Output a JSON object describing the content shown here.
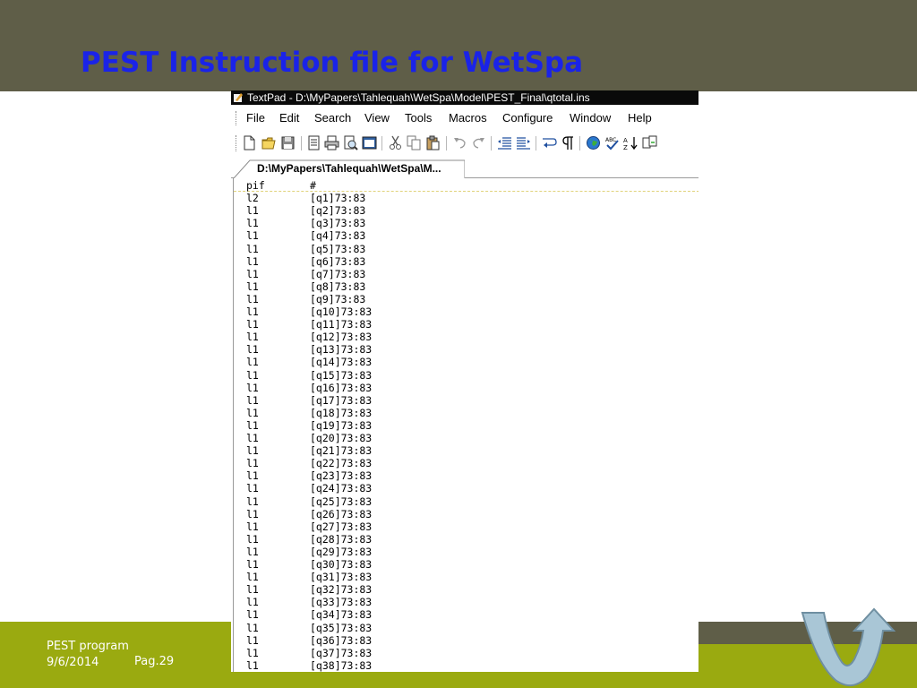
{
  "slide": {
    "title": "PEST Instruction file for WetSpa",
    "footer_program": "PEST program",
    "footer_date": "9/6/2014",
    "footer_page": "Pag.29"
  },
  "window": {
    "title": "TextPad - D:\\MyPapers\\Tahlequah\\WetSpa\\Model\\PEST_Final\\qtotal.ins",
    "menus": [
      "File",
      "Edit",
      "Search",
      "View",
      "Tools",
      "Macros",
      "Configure",
      "Window",
      "Help"
    ],
    "toolbar_icons": [
      "new-file-icon",
      "open-folder-icon",
      "save-icon",
      "document-properties-icon",
      "print-icon",
      "print-preview-icon",
      "manage-files-icon",
      "cut-icon",
      "copy-icon",
      "paste-icon",
      "undo-icon",
      "redo-icon",
      "decrease-indent-icon",
      "increase-indent-icon",
      "word-wrap-icon",
      "visible-spaces-icon",
      "web-browser-icon",
      "spell-check-icon",
      "sort-icon",
      "compare-icon"
    ],
    "tab_label": "D:\\MyPapers\\Tahlequah\\WetSpa\\M...",
    "colors": {
      "titlebar_bg": "#0a0a0a",
      "slide_band": "#5f5e48",
      "footer_band": "#9aaa10",
      "title_text": "#1a23e8"
    }
  },
  "file_lines": [
    [
      "pif",
      "#"
    ],
    [
      "l2",
      "[q1]73:83"
    ],
    [
      "l1",
      "[q2]73:83"
    ],
    [
      "l1",
      "[q3]73:83"
    ],
    [
      "l1",
      "[q4]73:83"
    ],
    [
      "l1",
      "[q5]73:83"
    ],
    [
      "l1",
      "[q6]73:83"
    ],
    [
      "l1",
      "[q7]73:83"
    ],
    [
      "l1",
      "[q8]73:83"
    ],
    [
      "l1",
      "[q9]73:83"
    ],
    [
      "l1",
      "[q10]73:83"
    ],
    [
      "l1",
      "[q11]73:83"
    ],
    [
      "l1",
      "[q12]73:83"
    ],
    [
      "l1",
      "[q13]73:83"
    ],
    [
      "l1",
      "[q14]73:83"
    ],
    [
      "l1",
      "[q15]73:83"
    ],
    [
      "l1",
      "[q16]73:83"
    ],
    [
      "l1",
      "[q17]73:83"
    ],
    [
      "l1",
      "[q18]73:83"
    ],
    [
      "l1",
      "[q19]73:83"
    ],
    [
      "l1",
      "[q20]73:83"
    ],
    [
      "l1",
      "[q21]73:83"
    ],
    [
      "l1",
      "[q22]73:83"
    ],
    [
      "l1",
      "[q23]73:83"
    ],
    [
      "l1",
      "[q24]73:83"
    ],
    [
      "l1",
      "[q25]73:83"
    ],
    [
      "l1",
      "[q26]73:83"
    ],
    [
      "l1",
      "[q27]73:83"
    ],
    [
      "l1",
      "[q28]73:83"
    ],
    [
      "l1",
      "[q29]73:83"
    ],
    [
      "l1",
      "[q30]73:83"
    ],
    [
      "l1",
      "[q31]73:83"
    ],
    [
      "l1",
      "[q32]73:83"
    ],
    [
      "l1",
      "[q33]73:83"
    ],
    [
      "l1",
      "[q34]73:83"
    ],
    [
      "l1",
      "[q35]73:83"
    ],
    [
      "l1",
      "[q36]73:83"
    ],
    [
      "l1",
      "[q37]73:83"
    ],
    [
      "l1",
      "[q38]73:83"
    ]
  ]
}
